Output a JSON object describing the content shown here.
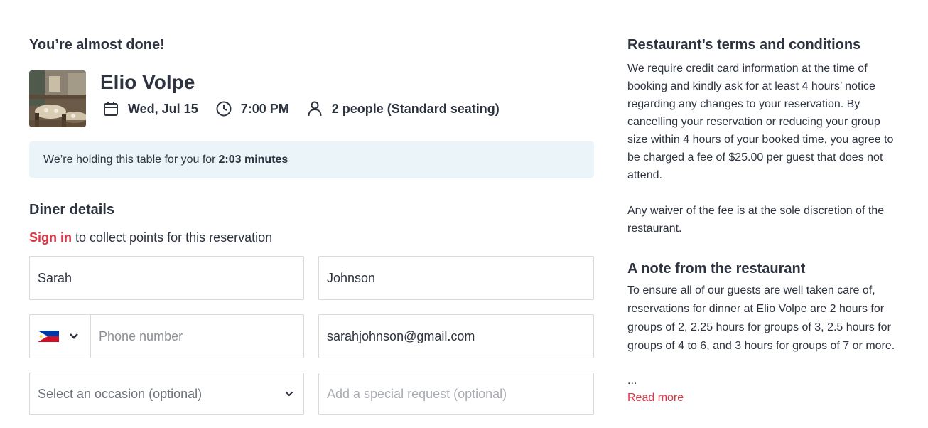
{
  "header": {
    "almost_done": "You’re almost done!"
  },
  "restaurant": {
    "name": "Elio Volpe",
    "date": "Wed, Jul 15",
    "time": "7:00 PM",
    "party": "2 people (Standard seating)"
  },
  "holding": {
    "prefix": "We’re holding this table for you for",
    "timer": "2:03 minutes"
  },
  "diner": {
    "title": "Diner details",
    "sign_in_link": "Sign in",
    "sign_in_suffix": " to collect points for this reservation",
    "first_name": "Sarah",
    "last_name": "Johnson",
    "phone_placeholder": "Phone number",
    "country_flag": "philippines-flag",
    "email": "sarahjohnson@gmail.com",
    "occasion_placeholder": "Select an occasion (optional)",
    "special_request_placeholder": "Add a special request (optional)"
  },
  "terms": {
    "title": "Restaurant’s terms and conditions",
    "paragraph1": "We require credit card information at the time of booking and kindly ask for at least 4 hours’ notice regarding any changes to your reservation. By cancelling your reservation or reducing your group size within 4 hours of your booked time, you agree to be charged a fee of $25.00 per guest that does not attend.",
    "paragraph2": "Any waiver of the fee is at the sole discretion of the restaurant."
  },
  "note": {
    "title": "A note from the restaurant",
    "text": "To ensure all of our guests are well taken care of, reservations for dinner at Elio Volpe are 2 hours for groups of 2, 2.25 hours for groups of 3, 2.5 hours for groups of 4 to 6, and 3 hours for groups of 7 or more.",
    "ellipsis": "...",
    "read_more": "Read more"
  },
  "colors": {
    "accent": "#da3743",
    "text": "#2d333f",
    "holding_bg": "#ebf4f8",
    "border": "#d8d9db"
  }
}
